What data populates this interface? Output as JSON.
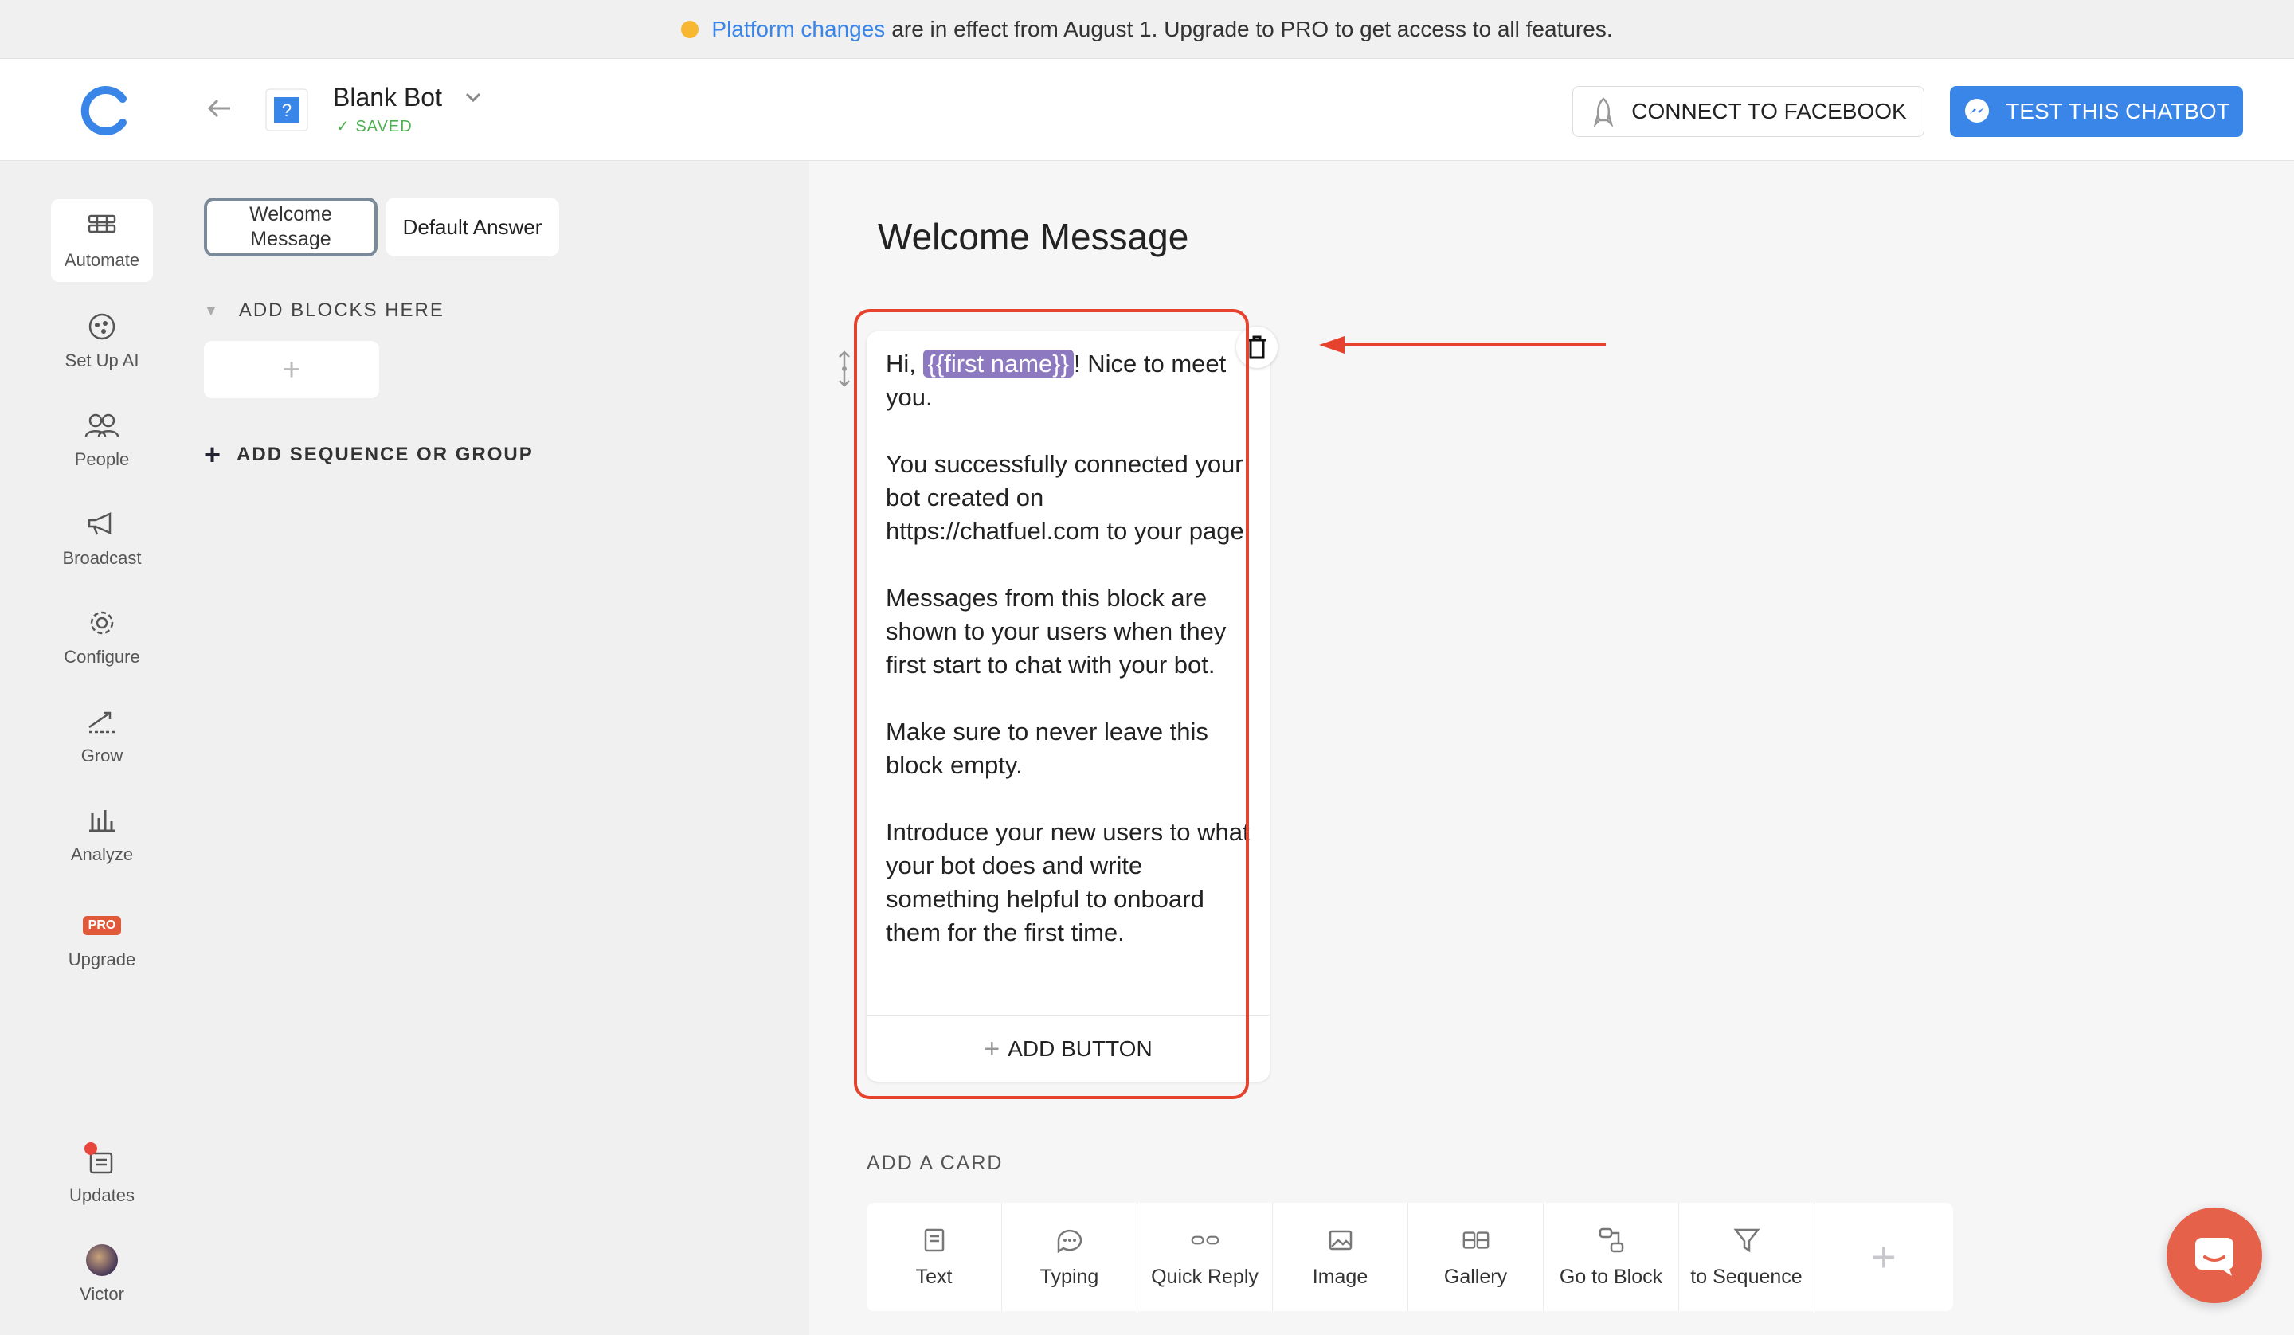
{
  "notice": {
    "link_text": "Platform changes",
    "text": "are in effect from August 1. Upgrade to PRO to get access to all features."
  },
  "header": {
    "bot_name": "Blank Bot",
    "saved_label": "SAVED",
    "connect_label": "CONNECT TO FACEBOOK",
    "test_label": "TEST THIS CHATBOT"
  },
  "sidebar": {
    "items": [
      {
        "label": "Automate",
        "icon": "automate-icon"
      },
      {
        "label": "Set Up AI",
        "icon": "ai-icon"
      },
      {
        "label": "People",
        "icon": "people-icon"
      },
      {
        "label": "Broadcast",
        "icon": "megaphone-icon"
      },
      {
        "label": "Configure",
        "icon": "gear-icon"
      },
      {
        "label": "Grow",
        "icon": "grow-icon"
      },
      {
        "label": "Analyze",
        "icon": "chart-icon"
      },
      {
        "label": "Upgrade",
        "icon": "pro-badge",
        "badge": "PRO"
      }
    ],
    "bottom": [
      {
        "label": "Updates",
        "icon": "updates-icon"
      },
      {
        "label": "Victor",
        "icon": "avatar"
      }
    ]
  },
  "blocks": {
    "tab_welcome": "Welcome Message",
    "tab_default": "Default Answer",
    "add_blocks_label": "ADD BLOCKS HERE",
    "add_sequence_label": "ADD SEQUENCE OR GROUP"
  },
  "main": {
    "title": "Welcome Message",
    "card": {
      "greeting_prefix": "Hi, ",
      "variable": "{{first name}}",
      "greeting_suffix": "! Nice to meet you.",
      "paragraphs": [
        "You successfully connected your bot created on https://chatfuel.com to your page.",
        "Messages from this block are shown to your users when they first start to chat with your bot.",
        "Make sure to never leave this block empty.",
        "Introduce your new users to what your bot does and write something helpful to onboard them for the first time."
      ],
      "add_button_label": "ADD BUTTON"
    },
    "add_card_label": "ADD A CARD",
    "card_types": [
      "Text",
      "Typing",
      "Quick Reply",
      "Image",
      "Gallery",
      "Go to Block",
      "to Sequence"
    ]
  },
  "colors": {
    "accent": "#3a86e8",
    "highlight": "#e5432e",
    "variable_chip": "#8d79bf",
    "pro": "#e05a3a",
    "saved": "#4caf50"
  }
}
